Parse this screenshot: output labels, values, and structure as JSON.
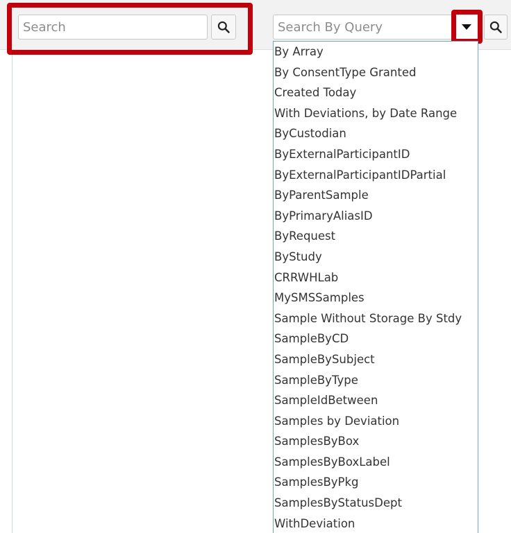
{
  "search": {
    "placeholder": "Search",
    "button_icon": "search-icon"
  },
  "query": {
    "placeholder": "Search By Query",
    "dropdown_icon": "caret-down-icon",
    "button_icon": "search-icon",
    "items": [
      "By Array",
      "By ConsentType Granted",
      "Created Today",
      "With Deviations, by Date Range",
      "ByCustodian",
      "ByExternalParticipantID",
      "ByExternalParticipantIDPartial",
      "ByParentSample",
      "ByPrimaryAliasID",
      "ByRequest",
      "ByStudy",
      "CRRWHLab",
      "MySMSSamples",
      "Sample Without Storage By Stdy",
      "SampleByCD",
      "SampleBySubject",
      "SampleByType",
      "SampleIdBetween",
      "Samples by Deviation",
      "SamplesByBox",
      "SamplesByBoxLabel",
      "SamplesByPkg",
      "SamplesByStatusDept",
      "WithDeviation"
    ]
  },
  "colors": {
    "highlight": "#c0000a",
    "dropdown_border": "#6fa3d6",
    "background_band": "#f2f2f2",
    "text": "#333333",
    "placeholder": "#8c8c8c"
  }
}
